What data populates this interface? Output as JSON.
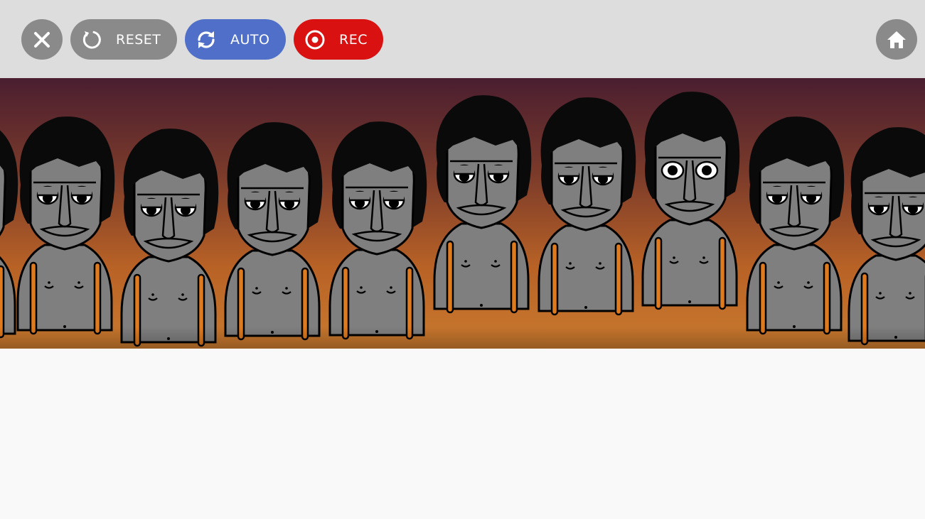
{
  "toolbar": {
    "close": {
      "icon": "close-icon",
      "color": "#8a8a8a"
    },
    "reset": {
      "label": "RESET",
      "icon": "reset-icon",
      "color": "#8a8a8a"
    },
    "auto": {
      "label": "AUTO",
      "icon": "refresh-icon",
      "color": "#4f6fc8"
    },
    "rec": {
      "label": "REC",
      "icon": "record-icon",
      "color": "#d91111"
    },
    "home": {
      "icon": "home-icon",
      "color": "#8a8a8a"
    }
  },
  "stage": {
    "background_top": "#4a1e2e",
    "background_bottom": "#c8702a",
    "character_count": 10,
    "skin": "#7f7f7f",
    "hair": "#0a0a0a",
    "accent": "#e07a1f"
  }
}
